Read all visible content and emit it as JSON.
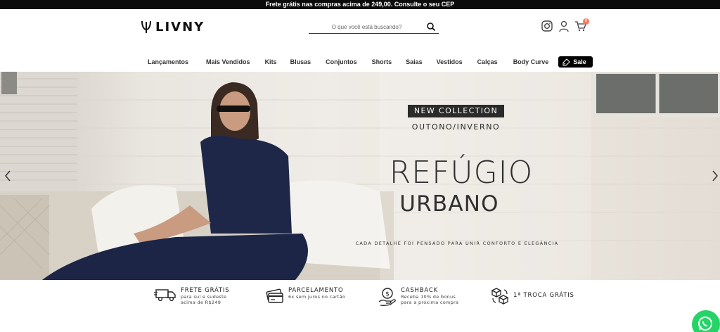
{
  "topbar": {
    "text": "Frete grátis nas compras acima de 249,00. Consulte o seu CEP"
  },
  "header": {
    "logo": "LIVNY",
    "search_placeholder": "O que você está buscando?",
    "cart_count": "0"
  },
  "nav": {
    "items": [
      "Lançamentos",
      "Mais Vendidos",
      "Kits",
      "Blusas",
      "Conjuntos",
      "Shorts",
      "Saias",
      "Vestidos",
      "Calças",
      "Body Curve"
    ],
    "sale_label": "Sale"
  },
  "hero": {
    "badge": "NEW COLLECTION",
    "season": "OUTONO/INVERNO",
    "title_line1": "REFÚGIO",
    "title_line2": "URBANO",
    "subtitle": "CADA DETALHE FOI PENSADO PARA UNIR CONFORTO E ELEGÂNCIA"
  },
  "benefits": [
    {
      "icon": "truck-icon",
      "title": "FRETE GRÁTIS",
      "lines": [
        "para sul e sudeste",
        "acima de R$249"
      ]
    },
    {
      "icon": "credit-card-icon",
      "title": "PARCELAMENTO",
      "lines": [
        "6x sem juros no cartão"
      ]
    },
    {
      "icon": "cashback-hand-icon",
      "title": "CASHBACK",
      "lines": [
        "Receba 10% de bonus",
        "para a próxima compra"
      ]
    },
    {
      "icon": "boxes-exchange-icon",
      "title": "1ª TROCA GRÁTIS",
      "lines": []
    }
  ],
  "colors": {
    "topbar": "#0c0c0c",
    "sale": "#000000",
    "whatsapp": "#25d366",
    "cart_badge": "#f47c5a"
  }
}
